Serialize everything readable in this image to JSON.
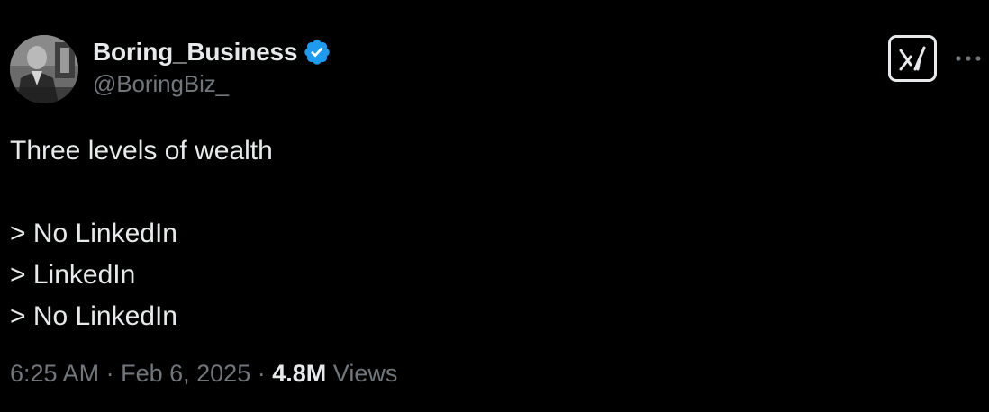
{
  "author": {
    "display_name": "Boring_Business",
    "handle": "@BoringBiz_",
    "verified": true,
    "verified_color": "#1d9bf0",
    "avatar_icon": "avatar-photo-icon"
  },
  "actions": {
    "grok_icon": "grok-icon",
    "more_icon": "more-dots-icon"
  },
  "tweet": {
    "lines": [
      "Three levels of wealth",
      "",
      "> No LinkedIn",
      "> LinkedIn",
      "> No LinkedIn"
    ]
  },
  "meta": {
    "time": "6:25 AM",
    "separator": "·",
    "date": "Feb 6, 2025",
    "views_count": "4.8M",
    "views_label": "Views"
  },
  "colors": {
    "background": "#000000",
    "primary_text": "#e7e9ea",
    "secondary_text": "#71767b"
  }
}
